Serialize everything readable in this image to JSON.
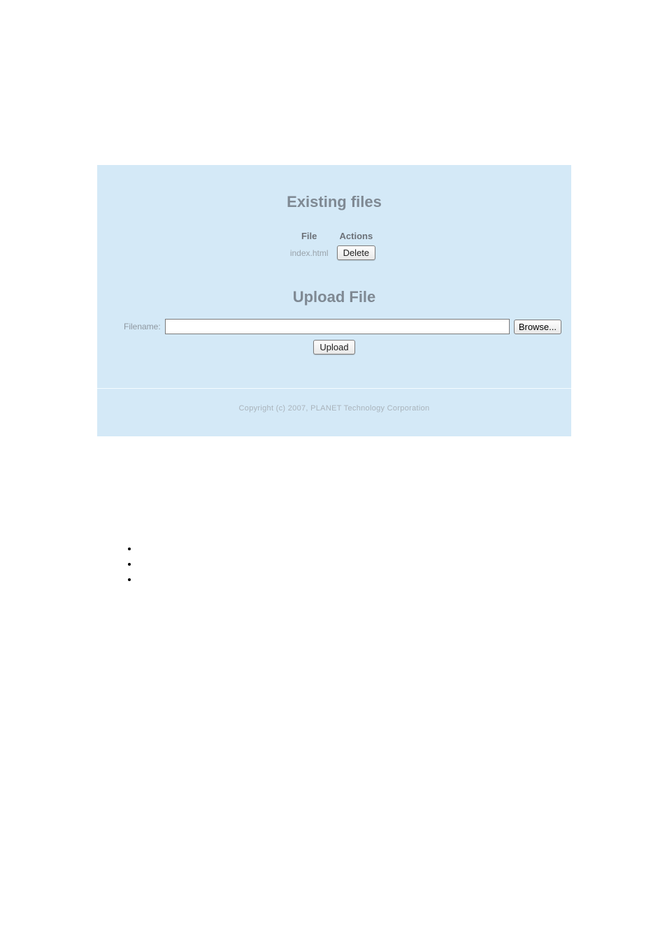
{
  "existing": {
    "title": "Existing files",
    "columns": {
      "file": "File",
      "actions": "Actions"
    },
    "rows": [
      {
        "file": "index.html",
        "delete_label": "Delete"
      }
    ]
  },
  "upload": {
    "title": "Upload File",
    "filename_label": "Filename:",
    "browse_label": "Browse...",
    "upload_label": "Upload",
    "filename_value": ""
  },
  "footer": {
    "copyright": "Copyright (c) 2007, PLANET Technology Corporation"
  }
}
